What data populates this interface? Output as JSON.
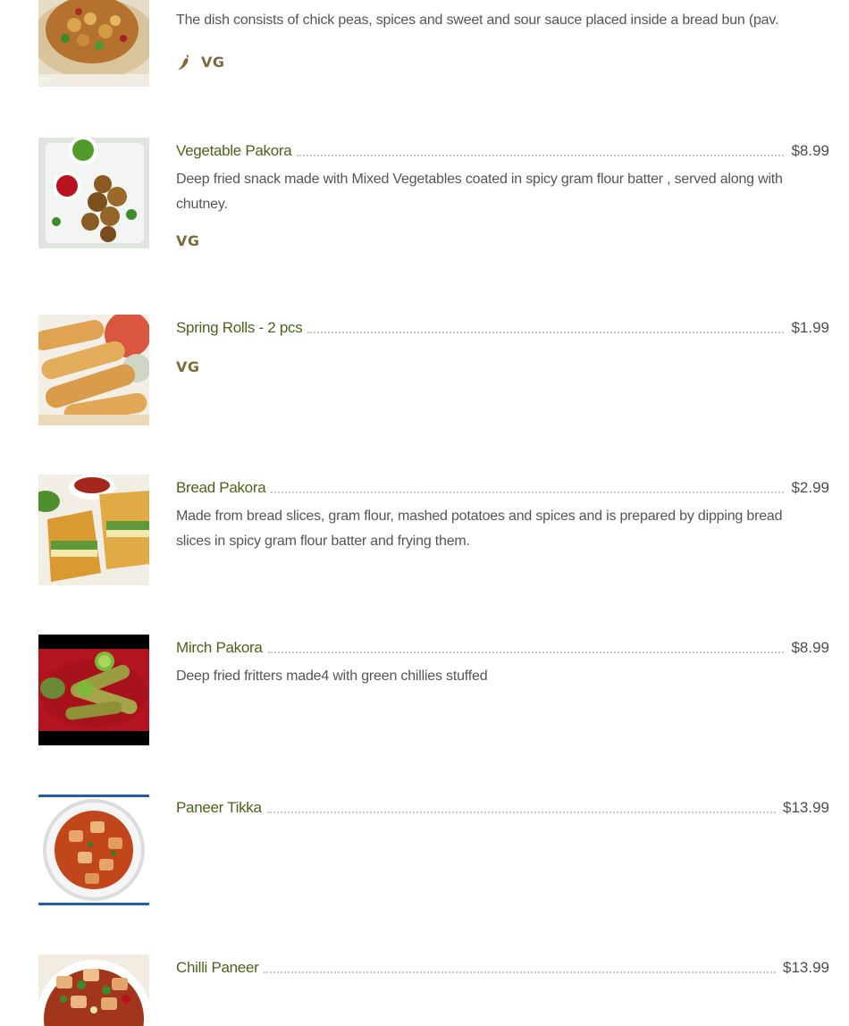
{
  "colors": {
    "item_name": "#4c621b",
    "price": "#4d4d4d",
    "description": "#555555",
    "tag": "#7b6a3a",
    "leader_dots": "#c8c8c8"
  },
  "menu": {
    "items": [
      {
        "name": "",
        "price": "",
        "description": "The dish consists of chick peas, spices and sweet and sour sauce placed inside a bread bun (pav.",
        "tags": [
          "spicy-icon",
          "VG"
        ]
      },
      {
        "name": "Vegetable Pakora",
        "price": "$8.99",
        "description": "Deep fried snack made with Mixed Vegetables coated in spicy gram flour batter , served along with chutney.",
        "tags": [
          "VG"
        ]
      },
      {
        "name": "Spring Rolls - 2 pcs",
        "price": "$1.99",
        "description": "",
        "tags": [
          "VG"
        ]
      },
      {
        "name": "Bread Pakora",
        "price": "$2.99",
        "description": "Made from bread slices, gram flour, mashed potatoes and spices and is prepared by dipping bread slices in spicy gram flour batter and frying them.",
        "tags": []
      },
      {
        "name": "Mirch Pakora",
        "price": "$8.99",
        "description": "Deep fried fritters made4 with green chillies stuffed",
        "tags": []
      },
      {
        "name": "Paneer Tikka",
        "price": "$13.99",
        "description": "",
        "tags": []
      },
      {
        "name": "Chilli Paneer",
        "price": "$13.99",
        "description": "",
        "tags": []
      }
    ]
  }
}
